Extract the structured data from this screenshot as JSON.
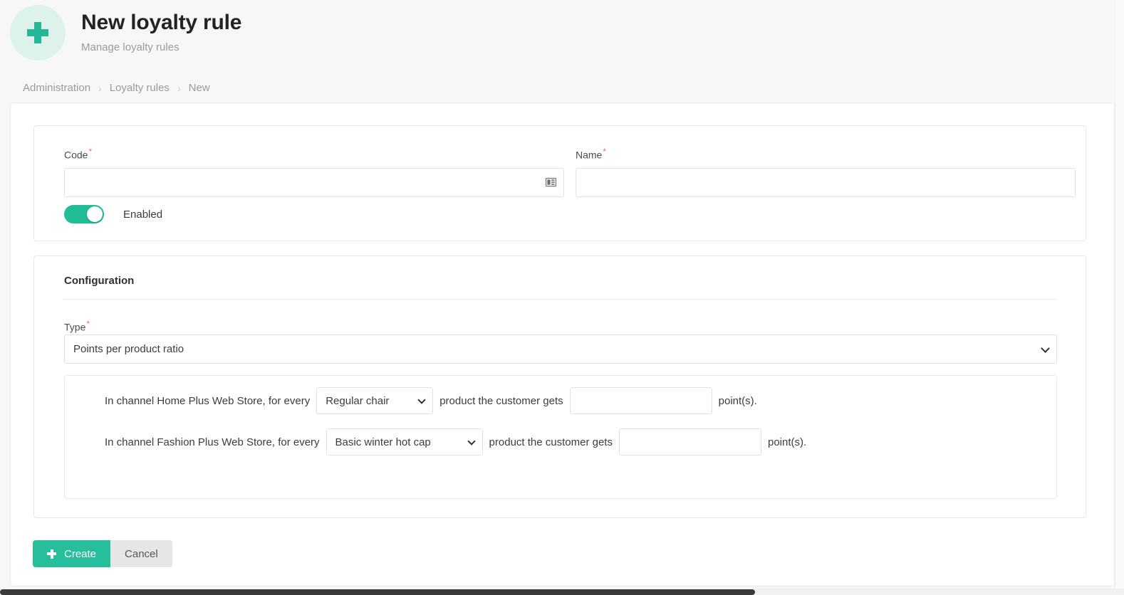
{
  "header": {
    "icon": "plus-icon",
    "title": "New loyalty rule",
    "subtitle": "Manage loyalty rules"
  },
  "breadcrumb": {
    "items": [
      {
        "label": "Administration"
      },
      {
        "label": "Loyalty rules"
      },
      {
        "label": "New"
      }
    ],
    "separator": "›"
  },
  "basic_card": {
    "code": {
      "label": "Code",
      "required_marker": "*",
      "value": "",
      "placeholder": "",
      "generator_icon": "id-card-generate-icon"
    },
    "name": {
      "label": "Name",
      "required_marker": "*",
      "value": "",
      "placeholder": ""
    },
    "enabled_toggle": {
      "label": "Enabled",
      "checked": true,
      "on_color": "#20bd97"
    }
  },
  "configuration": {
    "title": "Configuration",
    "type": {
      "label": "Type",
      "required_marker": "*",
      "selected": "Points per product ratio",
      "options": [
        "Points per product ratio"
      ]
    },
    "rules": [
      {
        "prefix": "In channel Home Plus Web Store, for every",
        "product_selected": "Regular chair",
        "product_options": [
          "Regular chair"
        ],
        "middle": "product the customer gets",
        "points_value": "",
        "points_placeholder": "",
        "suffix": "point(s)."
      },
      {
        "prefix": "In channel Fashion Plus Web Store, for every",
        "product_selected": "Basic winter hot cap",
        "product_options": [
          "Basic winter hot cap"
        ],
        "middle": "product the customer gets",
        "points_value": "",
        "points_placeholder": "",
        "suffix": "point(s)."
      }
    ]
  },
  "footer": {
    "create_label": "Create",
    "cancel_label": "Cancel"
  },
  "theme": {
    "accent": "#27bf9b",
    "accent_light": "#ddf2ea",
    "required_star": "#e8736b"
  }
}
